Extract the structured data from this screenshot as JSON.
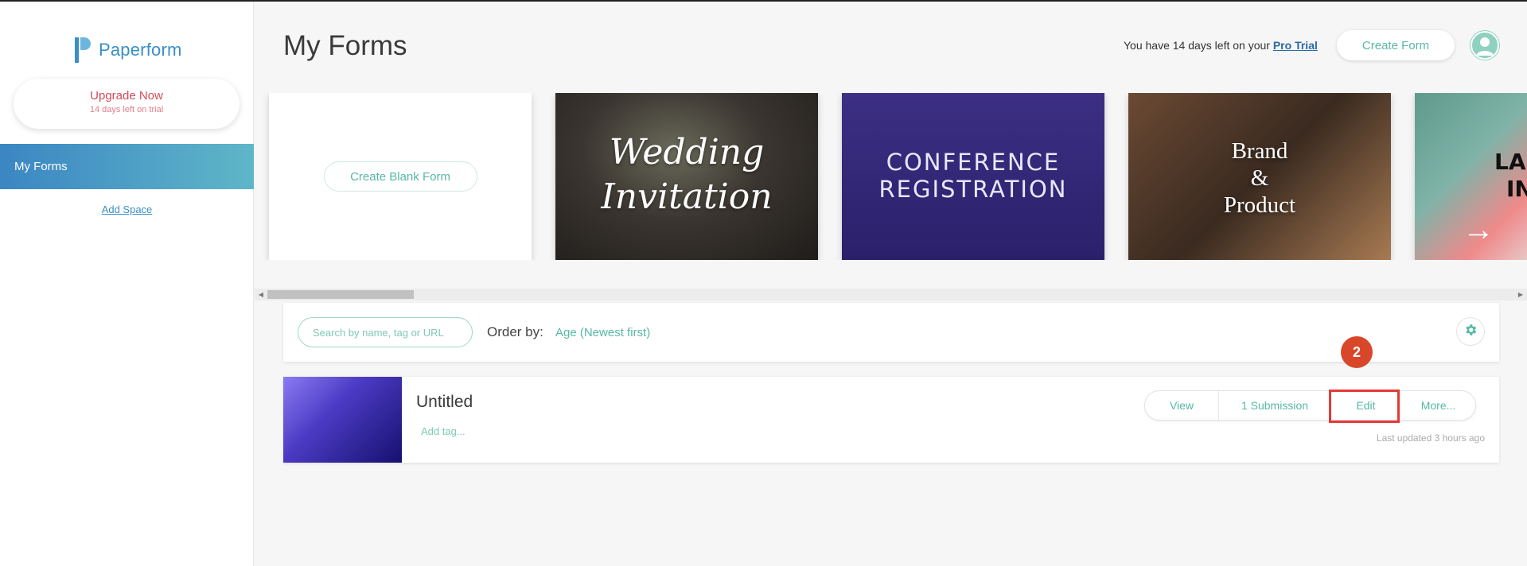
{
  "sidebar": {
    "logo_text": "Paperform",
    "upgrade": {
      "title": "Upgrade Now",
      "subtitle": "14 days left on trial"
    },
    "nav_active": "My Forms",
    "add_space": "Add Space"
  },
  "header": {
    "title": "My Forms",
    "trial_prefix": "You have 14 days left on your",
    "trial_link": "Pro Trial",
    "create_form": "Create Form",
    "avatar_icon": "user-avatar-icon"
  },
  "templates": {
    "blank_button": "Create Blank Form",
    "wedding": [
      "Wedding",
      "Invitation"
    ],
    "conference": [
      "CONFERENCE",
      "REGISTRATION"
    ],
    "brand": [
      "Brand",
      "&",
      "Product"
    ],
    "partial": [
      "LA",
      "IN"
    ],
    "arrow_icon": "arrow-right-icon"
  },
  "filter": {
    "search_placeholder": "Search by name, tag or URL",
    "order_label": "Order by:",
    "order_value": "Age (Newest first)",
    "settings_icon": "gear-icon"
  },
  "forms": [
    {
      "title": "Untitled",
      "add_tag": "Add tag...",
      "actions": {
        "view": "View",
        "submissions": "1 Submission",
        "edit": "Edit",
        "more": "More..."
      },
      "last_updated": "Last updated 3 hours ago"
    }
  ],
  "annotation": {
    "step_number": "2",
    "color": "#e53935"
  },
  "colors": {
    "accent": "#57b8a5",
    "brand_blue": "#3a8fc6",
    "upgrade_red": "#d64a5a"
  }
}
